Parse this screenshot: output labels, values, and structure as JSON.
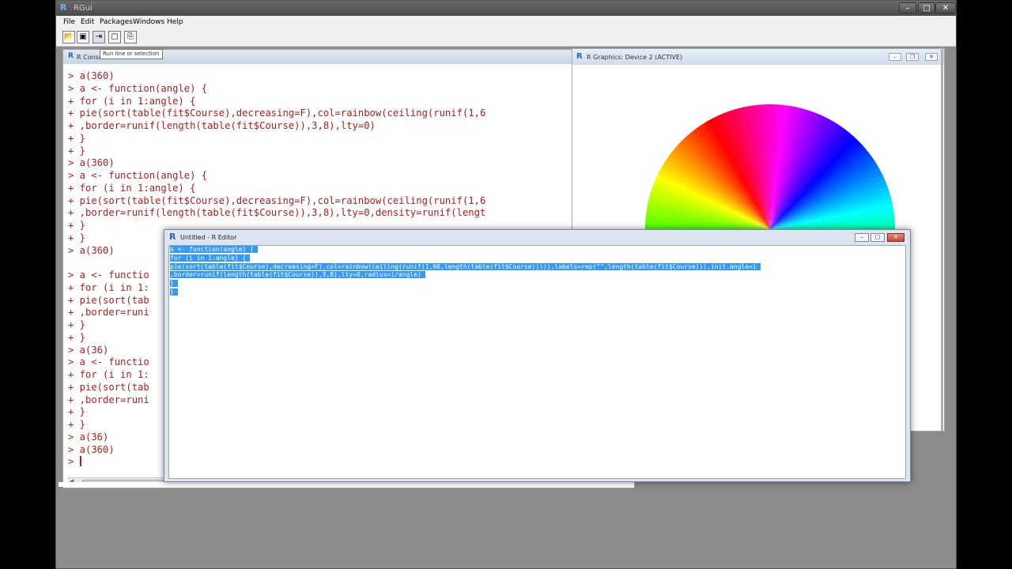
{
  "app": {
    "title": "RGui",
    "logo": "R"
  },
  "menu": [
    "File",
    "Edit",
    "Packages",
    "Windows",
    "Help"
  ],
  "toolbar": {
    "tooltip": "Run line or selection",
    "icons": [
      "open-script-icon",
      "save-icon",
      "run-line-icon",
      "console-icon",
      "print-icon"
    ]
  },
  "console": {
    "title": "R Console",
    "lines": [
      "> a(360)",
      "> a <- function(angle) {",
      "+ for (i in 1:angle) {",
      "+ pie(sort(table(fit$Course),decreasing=F),col=rainbow(ceiling(runif(1,6",
      "+ ,border=runif(length(table(fit$Course)),3,8),lty=0)",
      "+ }",
      "+ }",
      "> a(360)",
      "> a <- function(angle) {",
      "+ for (i in 1:angle) {",
      "+ pie(sort(table(fit$Course),decreasing=F),col=rainbow(ceiling(runif(1,6",
      "+ ,border=runif(length(table(fit$Course)),3,8),lty=0,density=runif(lengt",
      "+ }",
      "+ }",
      "> a(360)",
      "",
      "> a <- functio",
      "+ for (i in 1:",
      "+ pie(sort(tab",
      "+ ,border=runi",
      "+ }",
      "+ }",
      "> a(36)",
      "> a <- functio",
      "+ for (i in 1:",
      "+ pie(sort(tab",
      "+ ,border=runi",
      "+ }",
      "+ }",
      "> a(36)",
      "> a(360)"
    ],
    "prompt": "> "
  },
  "graphics": {
    "title": "R Graphics: Device 2 (ACTIVE)"
  },
  "editor": {
    "title": "Untitled - R Editor",
    "logo": "R",
    "lines": [
      "a <- function(angle) {",
      "for (i in 1:angle) {",
      "pie(sort(table(fit$Course),decreasing=F),col=rainbow(ceiling(runif(1,60,length(table(fit$Course))))),labels=rep(\"\",length(table(fit$Course))),init.angle=i",
      ",border=runif(length(table(fit$Course)),3,8),lty=0,radius=i/angle)",
      "}",
      "}"
    ]
  },
  "colors": {
    "console_text": "#b11c1c",
    "selection": "#3399ff"
  }
}
